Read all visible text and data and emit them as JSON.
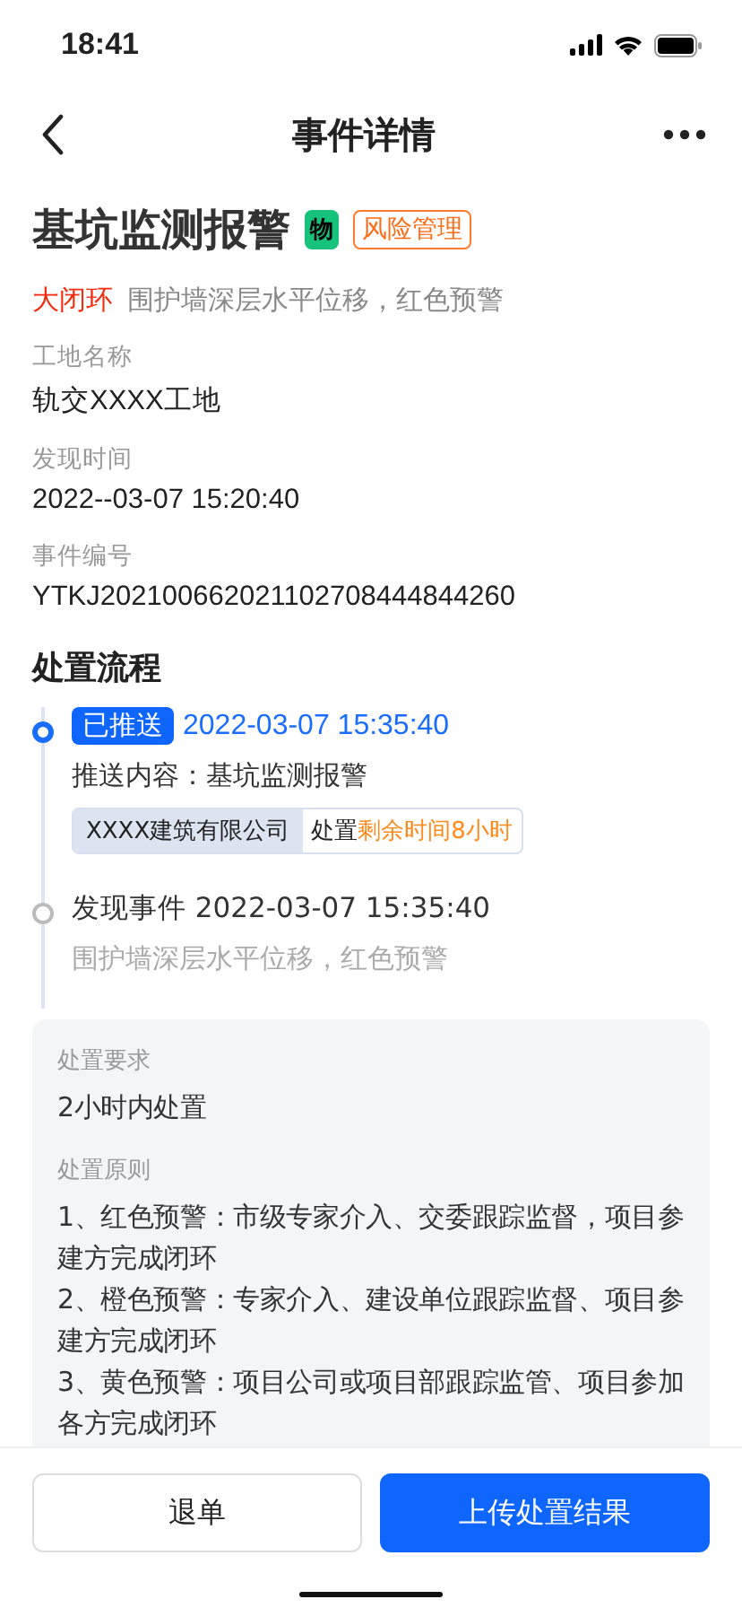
{
  "status_bar": {
    "time": "18:41"
  },
  "nav": {
    "title": "事件详情"
  },
  "event": {
    "title": "基坑监测报警",
    "type_badge": "物",
    "category_tag": "风险管理",
    "level": "大闭环",
    "summary": "围护墙深层水平位移，红色预警"
  },
  "fields": [
    {
      "label": "工地名称",
      "value": "轨交XXXX工地"
    },
    {
      "label": "发现时间",
      "value": "2022--03-07  15:20:40"
    },
    {
      "label": "事件编号",
      "value": "YTKJ202100662021102708444844260"
    }
  ],
  "process": {
    "heading": "处置流程",
    "steps": [
      {
        "kind": "push",
        "active": true,
        "badge": "已推送",
        "time": "2022-03-07 15:35:40",
        "content": "推送内容：基坑监测报警",
        "company": "XXXX建筑有限公司",
        "action": "处置",
        "remaining": "剩余时间8小时"
      },
      {
        "kind": "event",
        "active": false,
        "title": "发现事件 2022-03-07 15:35:40",
        "description": "围护墙深层水平位移，红色预警"
      }
    ]
  },
  "requirements": [
    {
      "label": "处置要求",
      "lines": [
        "2小时内处置"
      ]
    },
    {
      "label": "处置原则",
      "lines": [
        "1、红色预警：市级专家介入、交委跟踪监督，项目参建方完成闭环",
        "2、橙色预警：专家介入、建设单位跟踪监督、项目参建方完成闭环",
        "3、黄色预警：项目公司或项目部跟踪监管、项目参加各方完成闭环"
      ]
    }
  ],
  "actions": [
    {
      "kind": "secondary",
      "label": "退单"
    },
    {
      "kind": "primary",
      "label": "上传处置结果"
    }
  ]
}
